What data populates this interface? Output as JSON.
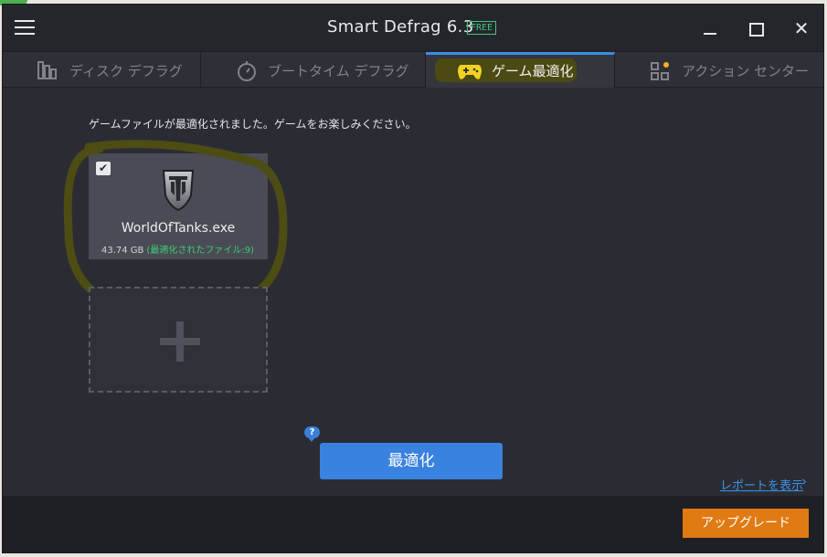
{
  "window": {
    "title": "Smart Defrag 6.3",
    "badge": "FREE"
  },
  "controls": {
    "minimize_icon": "minimize-icon",
    "maximize_icon": "maximize-icon",
    "close_glyph": "✕"
  },
  "tabs": [
    {
      "label": "ディスク デフラグ",
      "icon": "disk-defrag-icon"
    },
    {
      "label": "ブートタイム デフラグ",
      "icon": "boot-time-icon"
    },
    {
      "label": "ゲーム最適化",
      "icon": "gamepad-icon",
      "active": true
    },
    {
      "label": "アクション センター",
      "icon": "action-center-icon"
    }
  ],
  "main": {
    "message": "ゲームファイルが最適化されました。ゲームをお楽しみください。",
    "game": {
      "name": "WorldOfTanks.exe",
      "size": "43.74 GB",
      "optimized": "(最適化されたファイル:9)",
      "checked": true
    },
    "help_glyph": "?",
    "optimize_label": "最適化",
    "report_link": "レポートを表示",
    "report_chevron": "›"
  },
  "footer": {
    "upgrade_label": "アップグレード"
  },
  "colors": {
    "accent": "#3a82e0",
    "upgrade": "#e07a13",
    "free_badge": "#41c67a",
    "optimized_text": "#3ccf6f"
  }
}
